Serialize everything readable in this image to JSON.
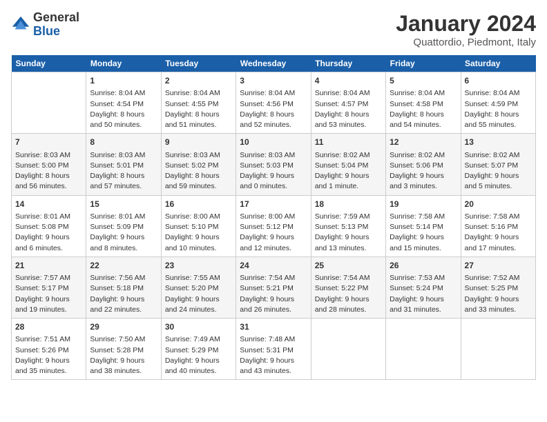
{
  "logo": {
    "general": "General",
    "blue": "Blue"
  },
  "header": {
    "month": "January 2024",
    "location": "Quattordio, Piedmont, Italy"
  },
  "weekdays": [
    "Sunday",
    "Monday",
    "Tuesday",
    "Wednesday",
    "Thursday",
    "Friday",
    "Saturday"
  ],
  "weeks": [
    [
      {
        "day": "",
        "sunrise": "",
        "sunset": "",
        "daylight": ""
      },
      {
        "day": "1",
        "sunrise": "Sunrise: 8:04 AM",
        "sunset": "Sunset: 4:54 PM",
        "daylight": "Daylight: 8 hours and 50 minutes."
      },
      {
        "day": "2",
        "sunrise": "Sunrise: 8:04 AM",
        "sunset": "Sunset: 4:55 PM",
        "daylight": "Daylight: 8 hours and 51 minutes."
      },
      {
        "day": "3",
        "sunrise": "Sunrise: 8:04 AM",
        "sunset": "Sunset: 4:56 PM",
        "daylight": "Daylight: 8 hours and 52 minutes."
      },
      {
        "day": "4",
        "sunrise": "Sunrise: 8:04 AM",
        "sunset": "Sunset: 4:57 PM",
        "daylight": "Daylight: 8 hours and 53 minutes."
      },
      {
        "day": "5",
        "sunrise": "Sunrise: 8:04 AM",
        "sunset": "Sunset: 4:58 PM",
        "daylight": "Daylight: 8 hours and 54 minutes."
      },
      {
        "day": "6",
        "sunrise": "Sunrise: 8:04 AM",
        "sunset": "Sunset: 4:59 PM",
        "daylight": "Daylight: 8 hours and 55 minutes."
      }
    ],
    [
      {
        "day": "7",
        "sunrise": "Sunrise: 8:03 AM",
        "sunset": "Sunset: 5:00 PM",
        "daylight": "Daylight: 8 hours and 56 minutes."
      },
      {
        "day": "8",
        "sunrise": "Sunrise: 8:03 AM",
        "sunset": "Sunset: 5:01 PM",
        "daylight": "Daylight: 8 hours and 57 minutes."
      },
      {
        "day": "9",
        "sunrise": "Sunrise: 8:03 AM",
        "sunset": "Sunset: 5:02 PM",
        "daylight": "Daylight: 8 hours and 59 minutes."
      },
      {
        "day": "10",
        "sunrise": "Sunrise: 8:03 AM",
        "sunset": "Sunset: 5:03 PM",
        "daylight": "Daylight: 9 hours and 0 minutes."
      },
      {
        "day": "11",
        "sunrise": "Sunrise: 8:02 AM",
        "sunset": "Sunset: 5:04 PM",
        "daylight": "Daylight: 9 hours and 1 minute."
      },
      {
        "day": "12",
        "sunrise": "Sunrise: 8:02 AM",
        "sunset": "Sunset: 5:06 PM",
        "daylight": "Daylight: 9 hours and 3 minutes."
      },
      {
        "day": "13",
        "sunrise": "Sunrise: 8:02 AM",
        "sunset": "Sunset: 5:07 PM",
        "daylight": "Daylight: 9 hours and 5 minutes."
      }
    ],
    [
      {
        "day": "14",
        "sunrise": "Sunrise: 8:01 AM",
        "sunset": "Sunset: 5:08 PM",
        "daylight": "Daylight: 9 hours and 6 minutes."
      },
      {
        "day": "15",
        "sunrise": "Sunrise: 8:01 AM",
        "sunset": "Sunset: 5:09 PM",
        "daylight": "Daylight: 9 hours and 8 minutes."
      },
      {
        "day": "16",
        "sunrise": "Sunrise: 8:00 AM",
        "sunset": "Sunset: 5:10 PM",
        "daylight": "Daylight: 9 hours and 10 minutes."
      },
      {
        "day": "17",
        "sunrise": "Sunrise: 8:00 AM",
        "sunset": "Sunset: 5:12 PM",
        "daylight": "Daylight: 9 hours and 12 minutes."
      },
      {
        "day": "18",
        "sunrise": "Sunrise: 7:59 AM",
        "sunset": "Sunset: 5:13 PM",
        "daylight": "Daylight: 9 hours and 13 minutes."
      },
      {
        "day": "19",
        "sunrise": "Sunrise: 7:58 AM",
        "sunset": "Sunset: 5:14 PM",
        "daylight": "Daylight: 9 hours and 15 minutes."
      },
      {
        "day": "20",
        "sunrise": "Sunrise: 7:58 AM",
        "sunset": "Sunset: 5:16 PM",
        "daylight": "Daylight: 9 hours and 17 minutes."
      }
    ],
    [
      {
        "day": "21",
        "sunrise": "Sunrise: 7:57 AM",
        "sunset": "Sunset: 5:17 PM",
        "daylight": "Daylight: 9 hours and 19 minutes."
      },
      {
        "day": "22",
        "sunrise": "Sunrise: 7:56 AM",
        "sunset": "Sunset: 5:18 PM",
        "daylight": "Daylight: 9 hours and 22 minutes."
      },
      {
        "day": "23",
        "sunrise": "Sunrise: 7:55 AM",
        "sunset": "Sunset: 5:20 PM",
        "daylight": "Daylight: 9 hours and 24 minutes."
      },
      {
        "day": "24",
        "sunrise": "Sunrise: 7:54 AM",
        "sunset": "Sunset: 5:21 PM",
        "daylight": "Daylight: 9 hours and 26 minutes."
      },
      {
        "day": "25",
        "sunrise": "Sunrise: 7:54 AM",
        "sunset": "Sunset: 5:22 PM",
        "daylight": "Daylight: 9 hours and 28 minutes."
      },
      {
        "day": "26",
        "sunrise": "Sunrise: 7:53 AM",
        "sunset": "Sunset: 5:24 PM",
        "daylight": "Daylight: 9 hours and 31 minutes."
      },
      {
        "day": "27",
        "sunrise": "Sunrise: 7:52 AM",
        "sunset": "Sunset: 5:25 PM",
        "daylight": "Daylight: 9 hours and 33 minutes."
      }
    ],
    [
      {
        "day": "28",
        "sunrise": "Sunrise: 7:51 AM",
        "sunset": "Sunset: 5:26 PM",
        "daylight": "Daylight: 9 hours and 35 minutes."
      },
      {
        "day": "29",
        "sunrise": "Sunrise: 7:50 AM",
        "sunset": "Sunset: 5:28 PM",
        "daylight": "Daylight: 9 hours and 38 minutes."
      },
      {
        "day": "30",
        "sunrise": "Sunrise: 7:49 AM",
        "sunset": "Sunset: 5:29 PM",
        "daylight": "Daylight: 9 hours and 40 minutes."
      },
      {
        "day": "31",
        "sunrise": "Sunrise: 7:48 AM",
        "sunset": "Sunset: 5:31 PM",
        "daylight": "Daylight: 9 hours and 43 minutes."
      },
      {
        "day": "",
        "sunrise": "",
        "sunset": "",
        "daylight": ""
      },
      {
        "day": "",
        "sunrise": "",
        "sunset": "",
        "daylight": ""
      },
      {
        "day": "",
        "sunrise": "",
        "sunset": "",
        "daylight": ""
      }
    ]
  ]
}
